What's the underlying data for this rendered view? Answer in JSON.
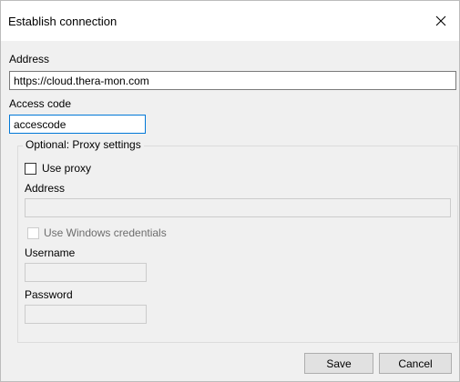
{
  "window": {
    "title": "Establish connection"
  },
  "connection": {
    "address_label": "Address",
    "address_value": "https://cloud.thera-mon.com",
    "access_code_label": "Access code",
    "access_code_value": "accescode"
  },
  "proxy": {
    "group_label": "Optional: Proxy settings",
    "use_proxy_label": "Use proxy",
    "use_proxy_checked": false,
    "address_label": "Address",
    "address_value": "",
    "use_windows_credentials_label": "Use Windows credentials",
    "use_windows_credentials_checked": false,
    "username_label": "Username",
    "username_value": "",
    "password_label": "Password",
    "password_value": ""
  },
  "buttons": {
    "save_label": "Save",
    "cancel_label": "Cancel"
  },
  "colors": {
    "dialog_background": "#f0f0f0",
    "title_background": "#ffffff",
    "focus_border": "#0078d7",
    "disabled_text": "#6d6d6d"
  },
  "icons": {
    "close": "close-icon"
  }
}
